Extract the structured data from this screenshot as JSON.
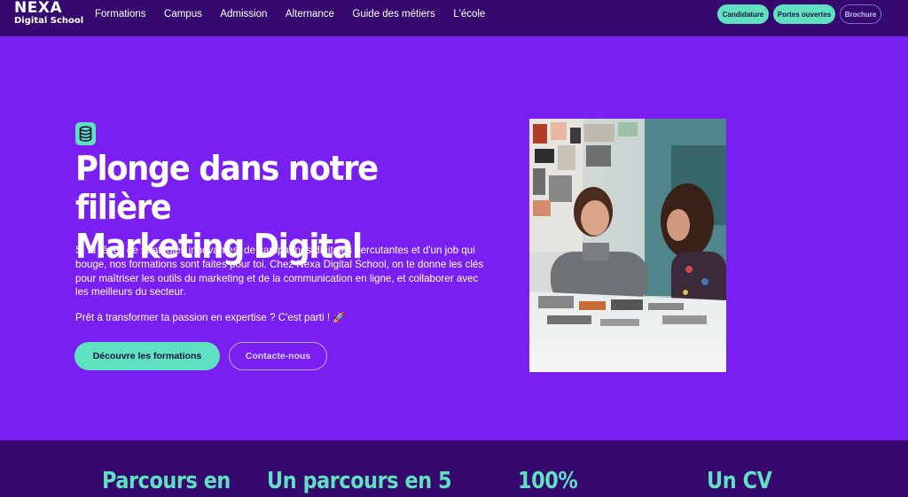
{
  "header": {
    "logo_line1": "NEXA",
    "logo_line2": "Digital School",
    "nav": [
      "Formations",
      "Campus",
      "Admission",
      "Alternance",
      "Guide des métiers",
      "L'école"
    ],
    "cta": {
      "candidature": "Candidature",
      "portes_ouvertes": "Portes ouvertes",
      "brochure": "Brochure"
    }
  },
  "hero": {
    "icon": "database-icon",
    "title_line1": "Plonge dans notre filière",
    "title_line2": "Marketing Digital",
    "description": "Si tu rêves de stratégies innovantes, de campagnes digitales percutantes et d'un job qui bouge, nos formations sont faites pour toi. Chez Nexa Digital School, on te donne les clés pour maîtriser les outils du marketing et de la communication en ligne, et collaborer avec les meilleurs du secteur.",
    "subline": "Prêt à transformer ta passion en expertise ? C'est parti ! 🚀",
    "primary_button": "Découvre les formations",
    "secondary_button": "Contacte-nous"
  },
  "stats": [
    "Parcours en",
    "Un parcours en 5",
    "100%",
    "Un CV"
  ],
  "colors": {
    "background": "#7a1ff2",
    "header": "#35096e",
    "accent": "#5fe0c0"
  }
}
